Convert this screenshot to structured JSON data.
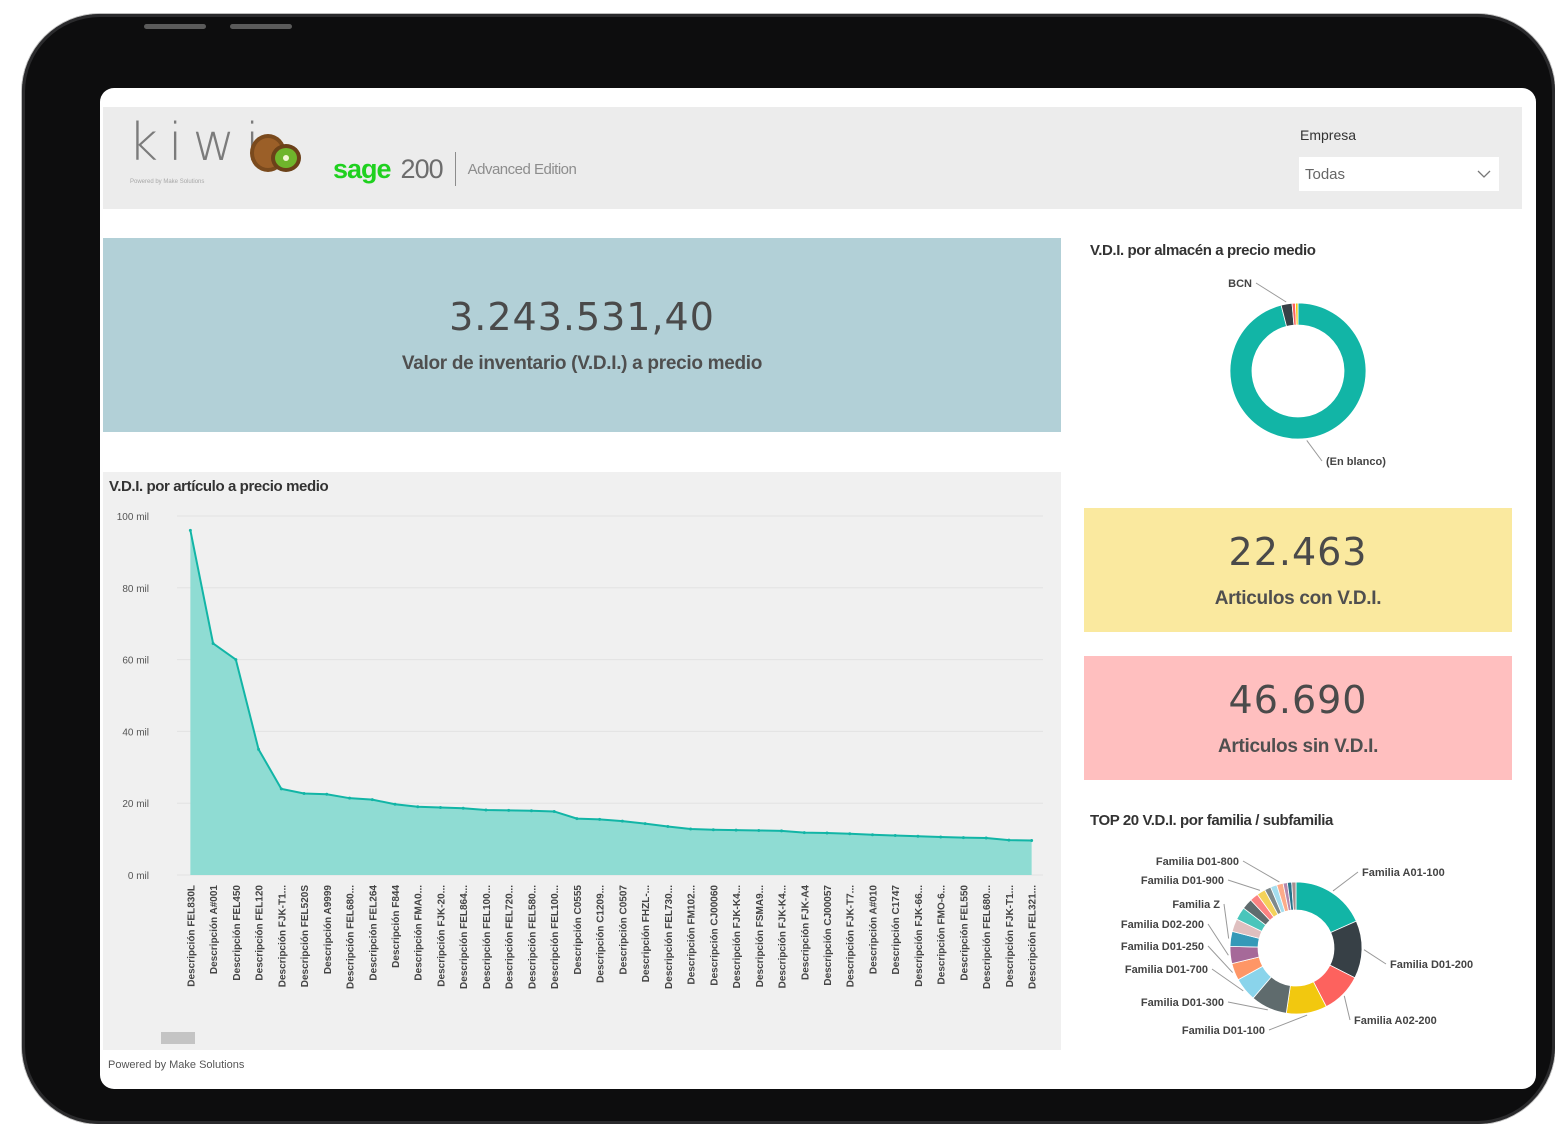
{
  "header": {
    "logo_text": "kiwi",
    "logo_subtext": "Powered by Make Solutions",
    "sage_word": "sage",
    "sage_version": "200",
    "sage_edition": "Advanced Edition",
    "filter_label": "Empresa",
    "filter_value": "Todas"
  },
  "kpis": {
    "total_value": "3.243.531,40",
    "total_label": "Valor de inventario (V.D.I.) a precio medio",
    "with_vdi_value": "22.463",
    "with_vdi_label": "Articulos con V.D.I.",
    "without_vdi_value": "46.690",
    "without_vdi_label": "Articulos sin V.D.I."
  },
  "colors": {
    "teal": "#12b5a6",
    "teal_fill": "#8fdcd3",
    "kpi_blue": "#b2d0d7",
    "kpi_yellow": "#fae99f",
    "kpi_red": "#ffbfbf",
    "sage_green": "#1fd11f"
  },
  "footer": {
    "powered": "Powered by Make Solutions"
  },
  "chart_data": [
    {
      "type": "area",
      "title": "V.D.I. por artículo a precio medio",
      "ylim": [
        0,
        100000
      ],
      "y_ticks": [
        "0 mil",
        "20 mil",
        "40 mil",
        "60 mil",
        "80 mil",
        "100 mil"
      ],
      "y_tick_values": [
        0,
        20000,
        40000,
        60000,
        80000,
        100000
      ],
      "grid": true,
      "categories": [
        "Descripción FEL830L",
        "Descripción A#001",
        "Descripción FEL450",
        "Descripción FEL120",
        "Descripción FJK-T1...",
        "Descripción FEL520S",
        "Descripción A9999",
        "Descripción FEL680...",
        "Descripción FEL264",
        "Descripción F844",
        "Descripción FMA0...",
        "Descripción FJK-20...",
        "Descripción FEL864...",
        "Descripción FEL100...",
        "Descripción FEL720...",
        "Descripción FEL580...",
        "Descripción FEL100...",
        "Descripción C0555",
        "Descripción C1209...",
        "Descripción C0507",
        "Descripción FHZL-...",
        "Descripción FEL730...",
        "Descripción FM102...",
        "Descripción CJ00060",
        "Descripción FJK-K4...",
        "Descripción FSMA9...",
        "Descripción FJK-K4...",
        "Descripción FJK-A4",
        "Descripción CJ00057",
        "Descripción FJK-T7...",
        "Descripción A#010",
        "Descripción C1747",
        "Descripción FJK-66...",
        "Descripción FMO-6...",
        "Descripción FEL550",
        "Descripción FEL680...",
        "Descripción FJK-T1...",
        "Descripción FEL321..."
      ],
      "values": [
        96000,
        64500,
        60000,
        35000,
        24000,
        22700,
        22500,
        21400,
        21000,
        19700,
        19000,
        18800,
        18600,
        18100,
        18000,
        17900,
        17700,
        15700,
        15500,
        15000,
        14300,
        13500,
        12800,
        12600,
        12500,
        12400,
        12300,
        11800,
        11700,
        11500,
        11200,
        11000,
        10800,
        10600,
        10400,
        10300,
        9700,
        9600
      ]
    },
    {
      "type": "pie",
      "title": "V.D.I. por almacén a precio medio",
      "labels": [
        "(En blanco)",
        "BCN",
        "",
        ""
      ],
      "values": [
        96,
        2.6,
        0.8,
        0.6
      ],
      "colors": [
        "#12b5a6",
        "#374046",
        "#fd625e",
        "#f2c80f"
      ],
      "label_items": [
        {
          "name": "BCN",
          "slice": 1
        },
        {
          "name": "(En blanco)",
          "slice": 0
        }
      ]
    },
    {
      "type": "pie",
      "title": "TOP 20 V.D.I. por familia / subfamilia",
      "labels": [
        "Familia A01-100",
        "Familia D01-200",
        "Familia A02-200",
        "Familia D01-100",
        "Familia D01-300",
        "Familia D01-700",
        "Familia D01-250",
        "Familia D02-200",
        "Familia Z",
        "",
        "",
        "",
        "",
        "Familia D01-900",
        "",
        "",
        "Familia D01-800",
        "",
        "",
        ""
      ],
      "values": [
        17.5,
        13.5,
        9.5,
        9.5,
        8.5,
        5.5,
        4.0,
        4.0,
        3.5,
        3.0,
        3.0,
        2.5,
        2.0,
        2.0,
        1.5,
        1.5,
        1.5,
        1.0,
        1.0,
        1.0
      ],
      "colors": [
        "#12b5a6",
        "#374046",
        "#fd625e",
        "#f2c80f",
        "#5f6b6d",
        "#8ad4eb",
        "#fe9666",
        "#a66999",
        "#3599b8",
        "#dfbfbf",
        "#4ac5bb",
        "#5f6b6d",
        "#fb8281",
        "#f4d25a",
        "#7f898a",
        "#a4ddee",
        "#fdab89",
        "#b687ac",
        "#28738a",
        "#a78f8f"
      ],
      "label_items": [
        {
          "name": "Familia D01-800",
          "slice": 16
        },
        {
          "name": "Familia D01-900",
          "slice": 13
        },
        {
          "name": "Familia Z",
          "slice": 8
        },
        {
          "name": "Familia D02-200",
          "slice": 7
        },
        {
          "name": "Familia D01-250",
          "slice": 6
        },
        {
          "name": "Familia D01-700",
          "slice": 5
        },
        {
          "name": "Familia D01-300",
          "slice": 4
        },
        {
          "name": "Familia D01-100",
          "slice": 3
        },
        {
          "name": "Familia A01-100",
          "slice": 0
        },
        {
          "name": "Familia D01-200",
          "slice": 1
        },
        {
          "name": "Familia A02-200",
          "slice": 2
        }
      ]
    }
  ]
}
